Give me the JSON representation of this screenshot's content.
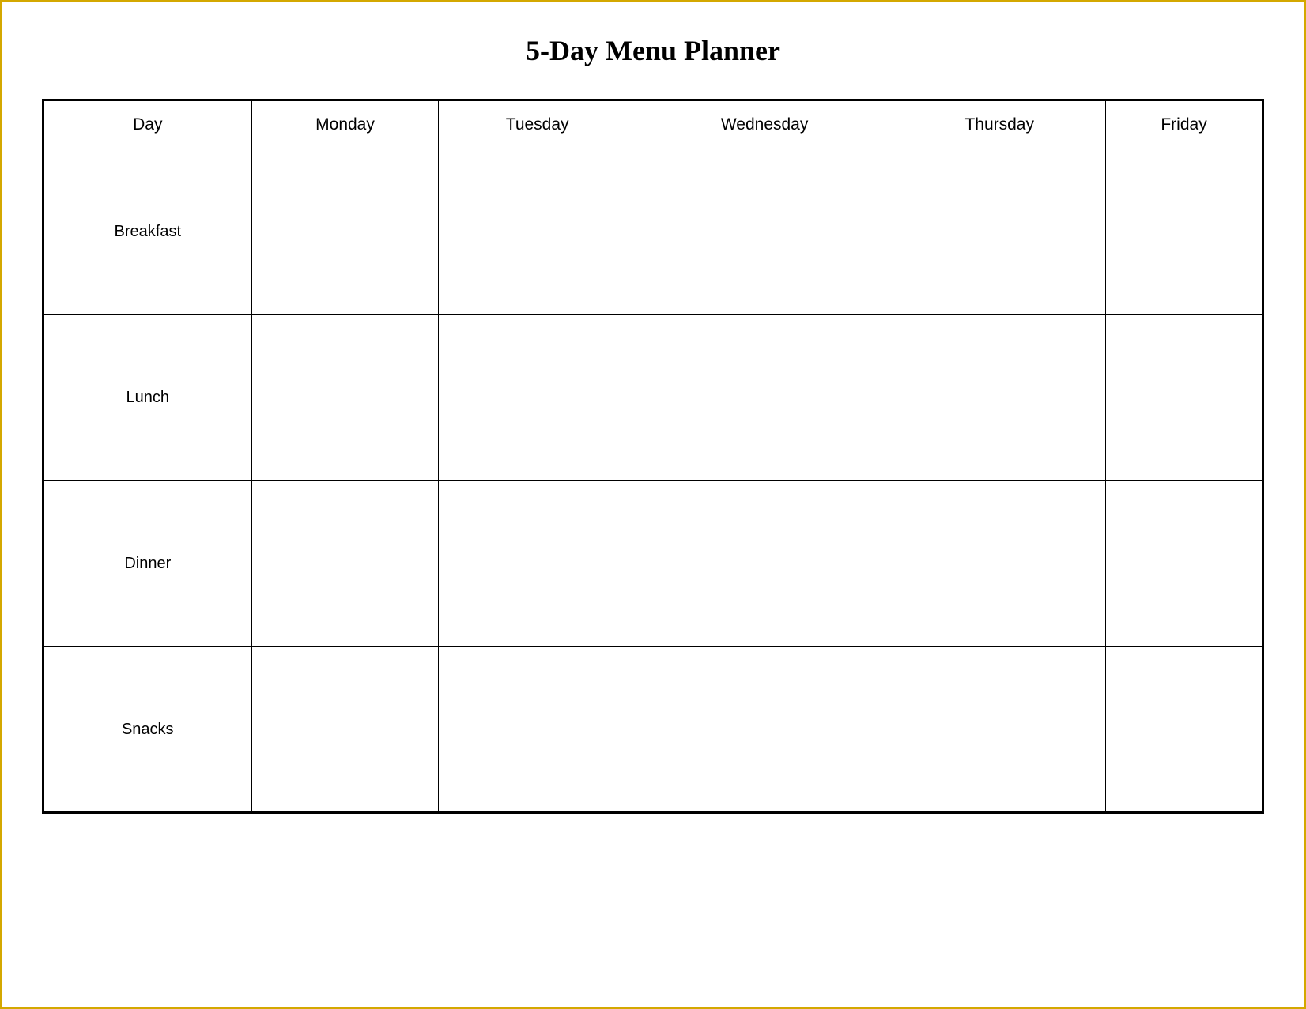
{
  "title": "5-Day Menu Planner",
  "headers": {
    "day": "Day",
    "monday": "Monday",
    "tuesday": "Tuesday",
    "wednesday": "Wednesday",
    "thursday": "Thursday",
    "friday": "Friday"
  },
  "rows": [
    {
      "label": "Breakfast"
    },
    {
      "label": "Lunch"
    },
    {
      "label": "Dinner"
    },
    {
      "label": "Snacks"
    }
  ]
}
